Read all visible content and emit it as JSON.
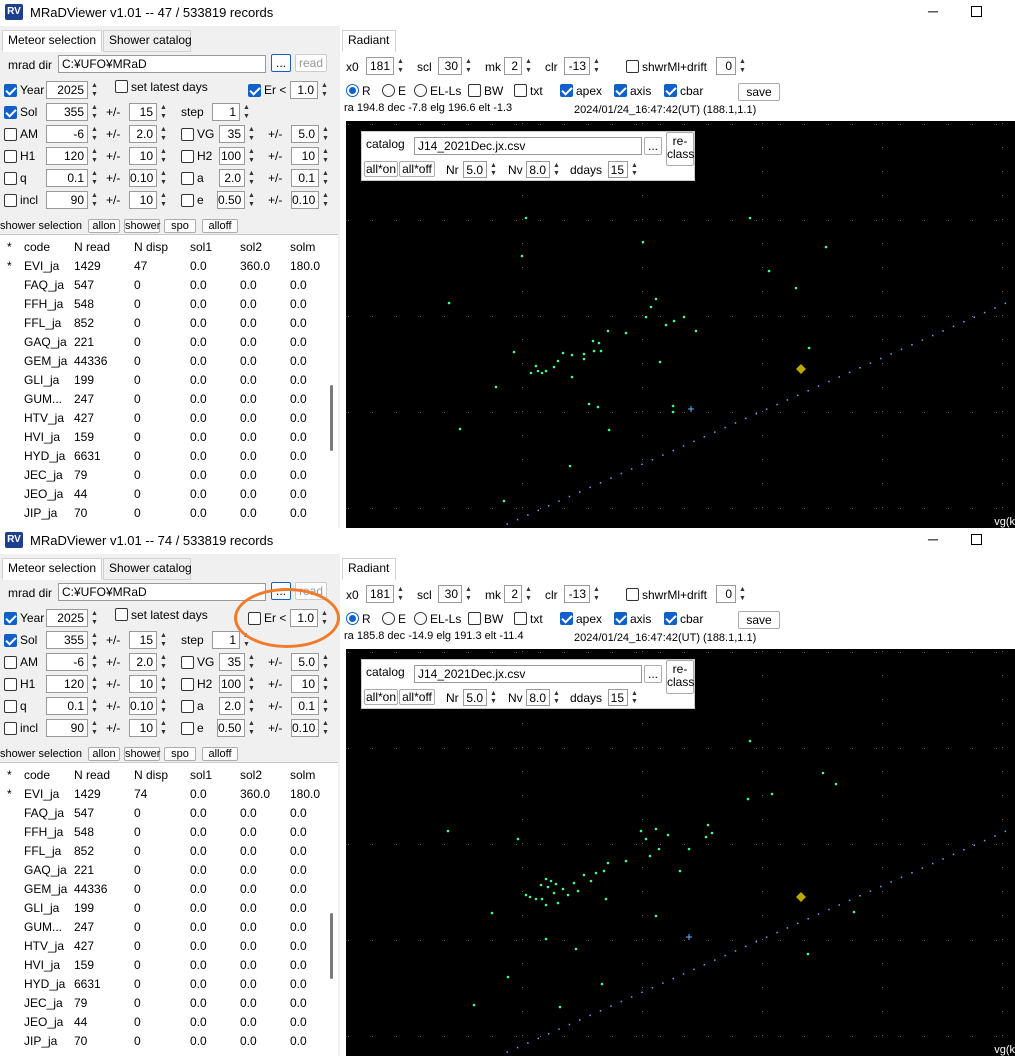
{
  "windows": [
    {
      "title": "MRaDViewer v1.01 --  47 / 533819 records",
      "app_icon": "RV",
      "tabs_left": [
        "Meteor selection",
        "Shower catalog"
      ],
      "tab_right": "Radiant",
      "mrad_dir_label": "mrad dir",
      "mrad_dir_value": "C:¥UFO¥MRaD",
      "browse_label": "...",
      "read_label": "read",
      "year": {
        "label": "Year",
        "checked": true,
        "value": "2025"
      },
      "set_latest_days": {
        "label": "set latest days",
        "checked": false
      },
      "er": {
        "label": "Er <",
        "checked": true,
        "value": "1.0"
      },
      "sol": {
        "label": "Sol",
        "checked": true,
        "value": "355",
        "pm": "+/-",
        "pm_value": "15",
        "step_label": "step",
        "step_value": "1"
      },
      "am": {
        "label": "AM",
        "checked": false,
        "value": "-6",
        "pm": "+/-",
        "pm_value": "2.0"
      },
      "vg": {
        "label": "VG",
        "checked": false,
        "value": "35",
        "pm": "+/-",
        "pm_value": "5.0"
      },
      "h1": {
        "label": "H1",
        "checked": false,
        "value": "120",
        "pm": "+/-",
        "pm_value": "10"
      },
      "h2": {
        "label": "H2",
        "checked": false,
        "value": "100",
        "pm": "+/-",
        "pm_value": "10"
      },
      "q": {
        "label": "q",
        "checked": false,
        "value": "0.1",
        "pm": "+/-",
        "pm_value": "0.10"
      },
      "a": {
        "label": "a",
        "checked": false,
        "value": "2.0",
        "pm": "+/-",
        "pm_value": "0.1"
      },
      "incl": {
        "label": "incl",
        "checked": false,
        "value": "90",
        "pm": "+/-",
        "pm_value": "10"
      },
      "e": {
        "label": "e",
        "checked": false,
        "value": "0.50",
        "pm": "+/-",
        "pm_value": "0.10"
      },
      "shower_selection_label": "shower selection",
      "allon_label": "allon",
      "shower_label": "shower",
      "spo_label": "spo",
      "alloff_label": "alloff",
      "columns": [
        "*",
        "code",
        "N read",
        "N disp",
        "sol1",
        "sol2",
        "solm"
      ],
      "rows": [
        [
          "*",
          "EVI_ja",
          "1429",
          "47",
          "0.0",
          "360.0",
          "180.0"
        ],
        [
          "",
          "FAQ_ja",
          "547",
          "0",
          "0.0",
          "0.0",
          "0.0"
        ],
        [
          "",
          "FFH_ja",
          "548",
          "0",
          "0.0",
          "0.0",
          "0.0"
        ],
        [
          "",
          "FFL_ja",
          "852",
          "0",
          "0.0",
          "0.0",
          "0.0"
        ],
        [
          "",
          "GAQ_ja",
          "221",
          "0",
          "0.0",
          "0.0",
          "0.0"
        ],
        [
          "",
          "GEM_ja",
          "44336",
          "0",
          "0.0",
          "0.0",
          "0.0"
        ],
        [
          "",
          "GLI_ja",
          "199",
          "0",
          "0.0",
          "0.0",
          "0.0"
        ],
        [
          "",
          "GUM...",
          "247",
          "0",
          "0.0",
          "0.0",
          "0.0"
        ],
        [
          "",
          "HTV_ja",
          "427",
          "0",
          "0.0",
          "0.0",
          "0.0"
        ],
        [
          "",
          "HVI_ja",
          "159",
          "0",
          "0.0",
          "0.0",
          "0.0"
        ],
        [
          "",
          "HYD_ja",
          "6631",
          "0",
          "0.0",
          "0.0",
          "0.0"
        ],
        [
          "",
          "JEC_ja",
          "79",
          "0",
          "0.0",
          "0.0",
          "0.0"
        ],
        [
          "",
          "JEO_ja",
          "44",
          "0",
          "0.0",
          "0.0",
          "0.0"
        ],
        [
          "",
          "JIP_ja",
          "70",
          "0",
          "0.0",
          "0.0",
          "0.0"
        ]
      ],
      "x0": {
        "label": "x0",
        "value": "181"
      },
      "scl": {
        "label": "scl",
        "value": "30"
      },
      "mk": {
        "label": "mk",
        "value": "2"
      },
      "clr": {
        "label": "clr",
        "value": "-13"
      },
      "shwr_drift": {
        "label": "shwrMl+drift",
        "checked": false,
        "value": "0"
      },
      "mode_r": "R",
      "mode_e": "E",
      "mode_ells": "EL-Ls",
      "bw": "BW",
      "txt": "txt",
      "apex": "apex",
      "axis": "axis",
      "cbar": "cbar",
      "save_label": "save",
      "status": "ra 194.8 dec -7.8 elg 196.6 elt -1.3",
      "timestamp": "2024/01/24_16:47:42(UT) (188.1,1.1)",
      "catalog_label": "catalog",
      "catalog_file": "J14_2021Dec.jx.csv",
      "reclass_label": "re-\nclass",
      "allon_btn": "all*on",
      "alloff_btn": "all*off",
      "nr": {
        "label": "Nr",
        "value": "5.0"
      },
      "nv": {
        "label": "Nv",
        "value": "8.0"
      },
      "ddays": {
        "label": "ddays",
        "value": "15"
      },
      "corner_text": "vg(k"
    },
    {
      "title": "MRaDViewer v1.01 --  74 / 533819 records",
      "app_icon": "RV",
      "tabs_left": [
        "Meteor selection",
        "Shower catalog"
      ],
      "tab_right": "Radiant",
      "mrad_dir_label": "mrad dir",
      "mrad_dir_value": "C:¥UFO¥MRaD",
      "browse_label": "...",
      "read_label": "read",
      "year": {
        "label": "Year",
        "checked": true,
        "value": "2025"
      },
      "set_latest_days": {
        "label": "set latest days",
        "checked": false
      },
      "er": {
        "label": "Er <",
        "checked": false,
        "value": "1.0"
      },
      "sol": {
        "label": "Sol",
        "checked": true,
        "value": "355",
        "pm": "+/-",
        "pm_value": "15",
        "step_label": "step",
        "step_value": "1"
      },
      "am": {
        "label": "AM",
        "checked": false,
        "value": "-6",
        "pm": "+/-",
        "pm_value": "2.0"
      },
      "vg": {
        "label": "VG",
        "checked": false,
        "value": "35",
        "pm": "+/-",
        "pm_value": "5.0"
      },
      "h1": {
        "label": "H1",
        "checked": false,
        "value": "120",
        "pm": "+/-",
        "pm_value": "10"
      },
      "h2": {
        "label": "H2",
        "checked": false,
        "value": "100",
        "pm": "+/-",
        "pm_value": "10"
      },
      "q": {
        "label": "q",
        "checked": false,
        "value": "0.1",
        "pm": "+/-",
        "pm_value": "0.10"
      },
      "a": {
        "label": "a",
        "checked": false,
        "value": "2.0",
        "pm": "+/-",
        "pm_value": "0.1"
      },
      "incl": {
        "label": "incl",
        "checked": false,
        "value": "90",
        "pm": "+/-",
        "pm_value": "10"
      },
      "e": {
        "label": "e",
        "checked": false,
        "value": "0.50",
        "pm": "+/-",
        "pm_value": "0.10"
      },
      "shower_selection_label": "shower selection",
      "allon_label": "allon",
      "shower_label": "shower",
      "spo_label": "spo",
      "alloff_label": "alloff",
      "columns": [
        "*",
        "code",
        "N read",
        "N disp",
        "sol1",
        "sol2",
        "solm"
      ],
      "rows": [
        [
          "*",
          "EVI_ja",
          "1429",
          "74",
          "0.0",
          "360.0",
          "180.0"
        ],
        [
          "",
          "FAQ_ja",
          "547",
          "0",
          "0.0",
          "0.0",
          "0.0"
        ],
        [
          "",
          "FFH_ja",
          "548",
          "0",
          "0.0",
          "0.0",
          "0.0"
        ],
        [
          "",
          "FFL_ja",
          "852",
          "0",
          "0.0",
          "0.0",
          "0.0"
        ],
        [
          "",
          "GAQ_ja",
          "221",
          "0",
          "0.0",
          "0.0",
          "0.0"
        ],
        [
          "",
          "GEM_ja",
          "44336",
          "0",
          "0.0",
          "0.0",
          "0.0"
        ],
        [
          "",
          "GLI_ja",
          "199",
          "0",
          "0.0",
          "0.0",
          "0.0"
        ],
        [
          "",
          "GUM...",
          "247",
          "0",
          "0.0",
          "0.0",
          "0.0"
        ],
        [
          "",
          "HTV_ja",
          "427",
          "0",
          "0.0",
          "0.0",
          "0.0"
        ],
        [
          "",
          "HVI_ja",
          "159",
          "0",
          "0.0",
          "0.0",
          "0.0"
        ],
        [
          "",
          "HYD_ja",
          "6631",
          "0",
          "0.0",
          "0.0",
          "0.0"
        ],
        [
          "",
          "JEC_ja",
          "79",
          "0",
          "0.0",
          "0.0",
          "0.0"
        ],
        [
          "",
          "JEO_ja",
          "44",
          "0",
          "0.0",
          "0.0",
          "0.0"
        ],
        [
          "",
          "JIP_ja",
          "70",
          "0",
          "0.0",
          "0.0",
          "0.0"
        ]
      ],
      "x0": {
        "label": "x0",
        "value": "181"
      },
      "scl": {
        "label": "scl",
        "value": "30"
      },
      "mk": {
        "label": "mk",
        "value": "2"
      },
      "clr": {
        "label": "clr",
        "value": "-13"
      },
      "shwr_drift": {
        "label": "shwrMl+drift",
        "checked": false,
        "value": "0"
      },
      "mode_r": "R",
      "mode_e": "E",
      "mode_ells": "EL-Ls",
      "bw": "BW",
      "txt": "txt",
      "apex": "apex",
      "axis": "axis",
      "cbar": "cbar",
      "save_label": "save",
      "status": "ra 185.8 dec -14.9 elg 191.3 elt -11.4",
      "timestamp": "2024/01/24_16:47:42(UT) (188.1,1.1)",
      "catalog_label": "catalog",
      "catalog_file": "J14_2021Dec.jx.csv",
      "reclass_label": "re-\nclass",
      "allon_btn": "all*on",
      "alloff_btn": "all*off",
      "nr": {
        "label": "Nr",
        "value": "5.0"
      },
      "nv": {
        "label": "Nv",
        "value": "8.0"
      },
      "ddays": {
        "label": "ddays",
        "value": "15"
      },
      "corner_text": "vg(k"
    }
  ],
  "colors": {
    "accent": "#1060c8",
    "highlight": "#f07c2b",
    "plot_bg": "#000000",
    "points": "#40ff90",
    "apex_marker": "#b8a800"
  }
}
